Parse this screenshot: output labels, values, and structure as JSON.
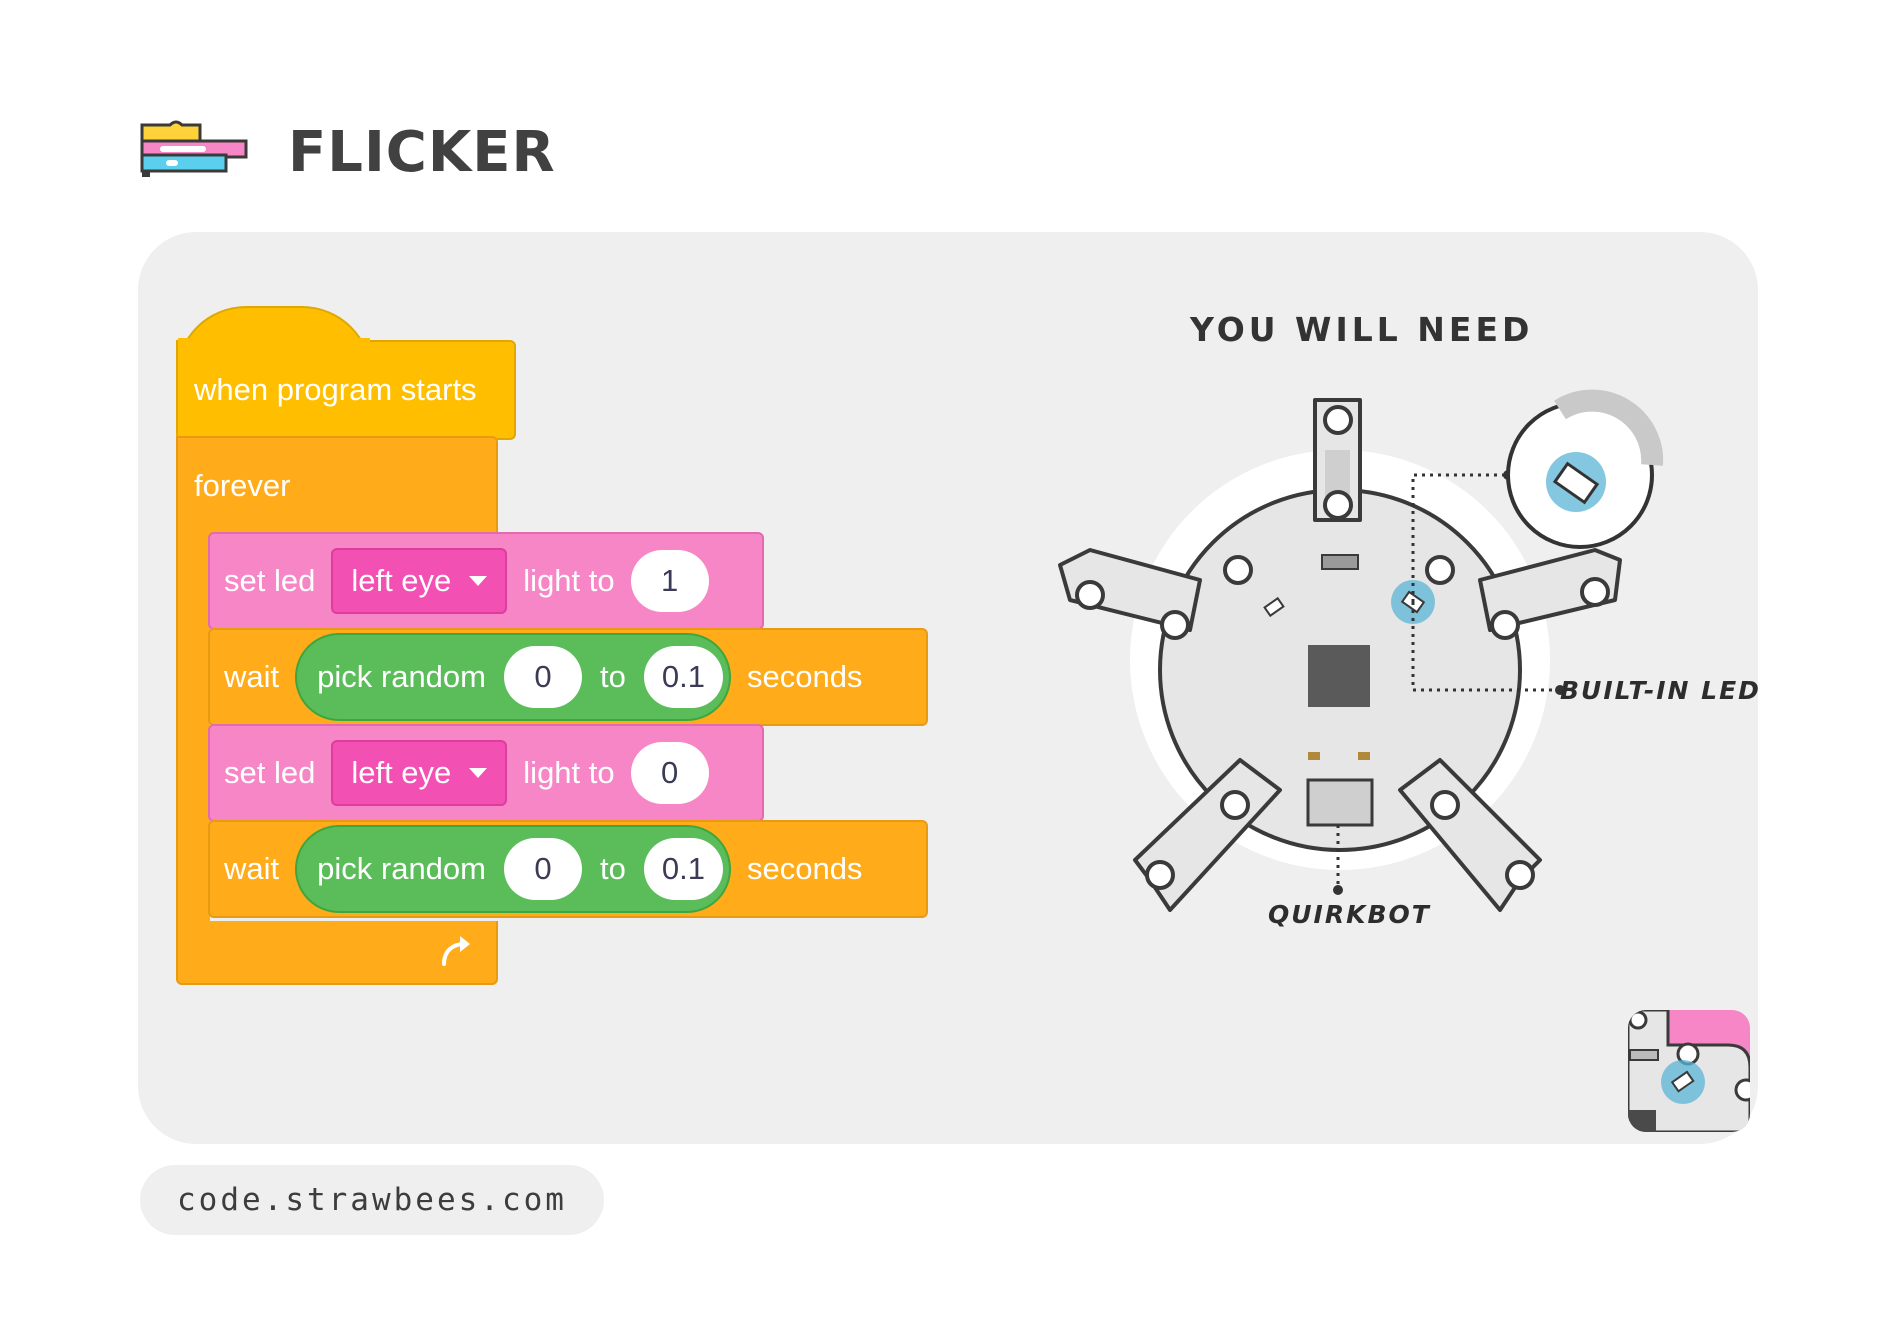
{
  "header": {
    "title": "FLICKER",
    "icon": "code-blocks-icon"
  },
  "program": {
    "hat": "when program starts",
    "forever": "forever",
    "forever_end_icon": "loop-arrow-icon",
    "steps": [
      {
        "set_led": "set led",
        "target": "left eye",
        "light_to": "light to",
        "value": "1"
      },
      {
        "wait": "wait",
        "pick_random": "pick random",
        "from": "0",
        "to_label": "to",
        "to": "0.1",
        "seconds": "seconds"
      },
      {
        "set_led": "set led",
        "target": "left eye",
        "light_to": "light to",
        "value": "0"
      },
      {
        "wait": "wait",
        "pick_random": "pick random",
        "from": "0",
        "to_label": "to",
        "to": "0.1",
        "seconds": "seconds"
      }
    ]
  },
  "you_will_need": {
    "title": "YOU WILL NEED",
    "labels": {
      "led": "BUILT-IN LED",
      "board": "QUIRKBOT"
    }
  },
  "footer": {
    "url": "code.strawbees.com"
  },
  "colors": {
    "hat": "#ffbf00",
    "control": "#ffab1a",
    "led": "#f686c6",
    "dropdown": "#f250b2",
    "operator": "#5bbd5a",
    "card": "#efefef",
    "led_highlight": "#5ab4d6"
  }
}
